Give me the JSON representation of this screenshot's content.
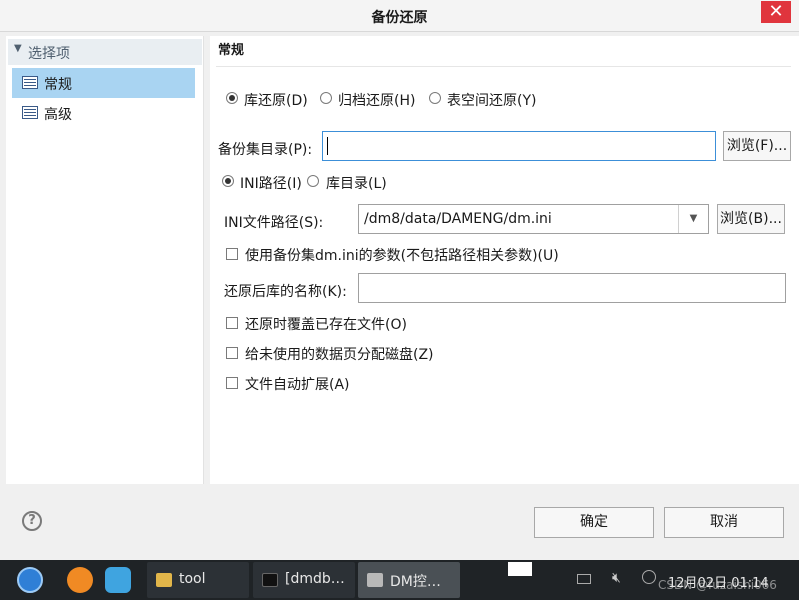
{
  "window": {
    "title": "备份还原",
    "close_glyph": "✕"
  },
  "sidebar": {
    "header": "选择项",
    "items": [
      {
        "label": "常规",
        "selected": true
      },
      {
        "label": "高级",
        "selected": false
      }
    ]
  },
  "section": {
    "title": "常规"
  },
  "restore_type": {
    "options": [
      "库还原(D)",
      "归档还原(H)",
      "表空间还原(Y)"
    ],
    "selected": "库还原(D)"
  },
  "backup_dir": {
    "label": "备份集目录(P):",
    "value": "",
    "browse_label": "浏览(F)..."
  },
  "path_mode": {
    "options": [
      "INI路径(I)",
      "库目录(L)"
    ],
    "selected": "INI路径(I)"
  },
  "ini_path": {
    "label": "INI文件路径(S):",
    "value": "/dm8/data/DAMENG/dm.ini",
    "browse_label": "浏览(B)..."
  },
  "checkboxes": {
    "use_backup_ini": "使用备份集dm.ini的参数(不包括路径相关参数)(U)",
    "overwrite": "还原时覆盖已存在文件(O)",
    "allocate_disk": "给未使用的数据页分配磁盘(Z)",
    "auto_extend": "文件自动扩展(A)"
  },
  "db_name": {
    "label": "还原后库的名称(K):",
    "value": ""
  },
  "footer": {
    "help_glyph": "?",
    "ok_label": "确定",
    "cancel_label": "取消"
  },
  "taskbar": {
    "windows": [
      {
        "label": "tool",
        "icon": "folder-icon"
      },
      {
        "label": "[dmdb…",
        "icon": "terminal-icon"
      },
      {
        "label": "DM控…",
        "icon": "dm-console-icon"
      }
    ],
    "datetime": "12月02日 01:14",
    "watermark": "CSDN @fuzaishi066"
  },
  "colors": {
    "selection": "#a9d4f2",
    "focus": "#3c8fd8",
    "close": "#e0353d",
    "taskbar": "#1f2326"
  }
}
